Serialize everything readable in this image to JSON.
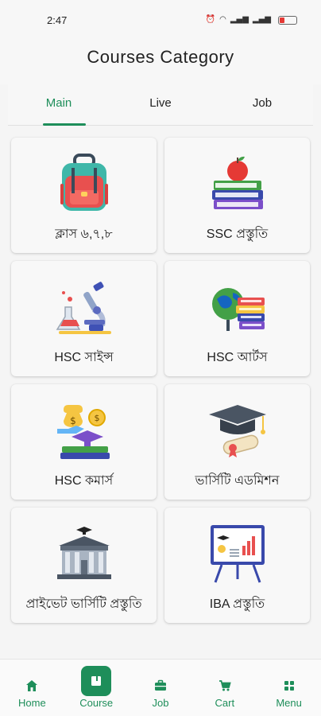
{
  "status_bar": {
    "time": "2:47"
  },
  "header": {
    "title": "Courses Category"
  },
  "tabs": [
    {
      "label": "Main",
      "active": true
    },
    {
      "label": "Live",
      "active": false
    },
    {
      "label": "Job",
      "active": false
    }
  ],
  "categories": [
    {
      "label": "ক্লাস ৬,৭,৮",
      "icon": "backpack-icon"
    },
    {
      "label": "SSC প্রস্তুতি",
      "icon": "books-apple-icon"
    },
    {
      "label": "HSC সাইন্স",
      "icon": "microscope-icon"
    },
    {
      "label": "HSC আর্টস",
      "icon": "globe-books-icon"
    },
    {
      "label": "HSC কমার্স",
      "icon": "money-books-icon"
    },
    {
      "label": "ভার্সিটি এডমিশন",
      "icon": "graduation-cap-icon"
    },
    {
      "label": "প্রাইভেট ভার্সিটি প্রস্তুতি",
      "icon": "university-building-icon"
    },
    {
      "label": "IBA প্রস্তুতি",
      "icon": "presentation-board-icon"
    }
  ],
  "bottom_nav": [
    {
      "label": "Home",
      "icon": "home-icon",
      "active": false
    },
    {
      "label": "Course",
      "icon": "book-icon",
      "active": true
    },
    {
      "label": "Job",
      "icon": "briefcase-icon",
      "active": false
    },
    {
      "label": "Cart",
      "icon": "cart-icon",
      "active": false
    },
    {
      "label": "Menu",
      "icon": "grid-menu-icon",
      "active": false
    }
  ],
  "colors": {
    "accent": "#1e8e5a"
  }
}
